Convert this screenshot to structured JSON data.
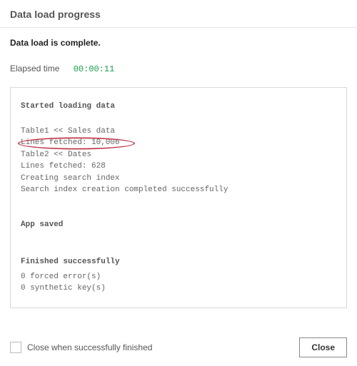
{
  "header": {
    "title": "Data load progress"
  },
  "status": {
    "message": "Data load is complete."
  },
  "elapsed": {
    "label": "Elapsed time",
    "value": "00:00:11"
  },
  "log": {
    "started_heading": "Started loading data",
    "lines": [
      "Table1 << Sales data",
      "Lines fetched: 10,006",
      "Table2 << Dates",
      "Lines fetched: 628",
      "Creating search index",
      "Search index creation completed successfully"
    ],
    "app_saved_heading": "App saved",
    "finished_heading": "Finished successfully",
    "finished_lines": [
      "0 forced error(s)",
      "0 synthetic key(s)"
    ],
    "highlight": {
      "line_index": 1,
      "color": "#c0394d"
    }
  },
  "footer": {
    "checkbox_label": "Close when successfully finished",
    "checkbox_checked": false,
    "close_button_label": "Close"
  }
}
